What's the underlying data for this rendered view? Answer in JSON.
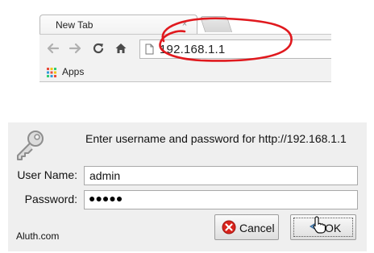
{
  "browser": {
    "tab": {
      "title": "New Tab",
      "close_glyph": "×"
    },
    "toolbar": {
      "back_icon": "back-arrow-icon",
      "forward_icon": "forward-arrow-icon",
      "reload_icon": "reload-icon",
      "home_icon": "home-icon",
      "url": "192.168.1.1"
    },
    "bookmarks": {
      "apps_label": "Apps"
    },
    "annotation_color": "#e0191e"
  },
  "dialog": {
    "message": "Enter username and password for http://192.168.1.1",
    "username_label": "User Name:",
    "username_value": "admin",
    "password_label": "Password:",
    "password_mask": "●●●●●",
    "cancel_label": "Cancel",
    "ok_label": "OK",
    "brand": "Aluth.com"
  }
}
